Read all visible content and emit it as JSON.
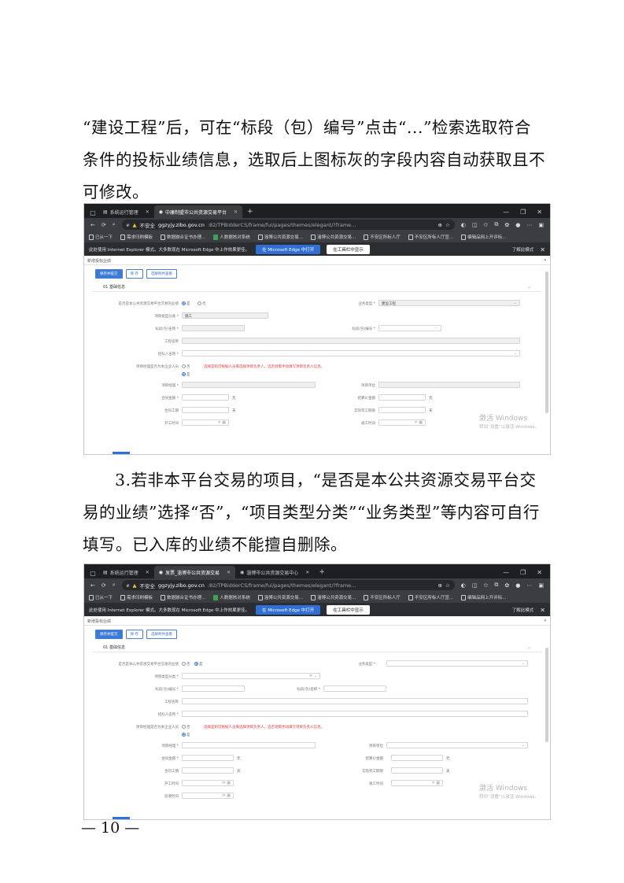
{
  "paragraph1": "“建设工程”后，可在“标段（包）编号”点击“...”检索选取符合条件的投标业绩信息，选取后上图标灰的字段内容自动获取且不可修改。",
  "paragraph2": "3.若非本平台交易的项目，“是否是本公共资源交易平台交易的业绩”选择“否”，“项目类型分类”“业务类型”等内容可自行填写。已入库的业绩不能擅自删除。",
  "page_number": "— 10 —",
  "screenshot1": {
    "tabs": [
      {
        "label": "系统运行管理",
        "active": false
      },
      {
        "label": "中康制盟市公共资源交易平台",
        "active": true
      }
    ],
    "address": {
      "security": "不安全",
      "host": "ggzyjy.zibo.gov.cn",
      "path": ":82/TPBidderCS/frame/fui/pages/themes/elegant/?frame..."
    },
    "bookmarks": [
      "已从一下",
      "需求印刷模板",
      "数据融合证书办理...",
      "人数据核对系统",
      "淄博公共资源交易...",
      "淄博公共资源交易...",
      "不安区所标人厅",
      "不安区所标人厅宣...",
      "编辑品网上开评标..."
    ],
    "ie_message": "此处使用 Internet Explorer 模式。大多数现在 Microsoft Edge 中上作效果更佳。",
    "ie_button1": "在 Microsoft Edge 中打开",
    "ie_button2": "在工具栏中显示",
    "ie_link": "了解此模式",
    "panel_title": "新增投标业绩",
    "buttons": [
      "保存并提交",
      "保 存",
      "选择附件查看"
    ],
    "section_title": "01 基础信息",
    "watermark_title": "激活 Windows",
    "watermark_sub": "转到“设置”以激活 Windows。",
    "form": {
      "q_platform": "是否是本公共资源交易平台交易的业绩",
      "opt_yes": "是",
      "opt_no": "否",
      "business_type_label": "业务类型",
      "business_type_value": "建设工程",
      "project_type_label": "项目类型分类",
      "project_type_value": "施工",
      "section_no_label": "标段(包)编号",
      "section_name_label": "标段(包)名称",
      "project_name_label": "工程名称",
      "tenderee_label": "招标人名称",
      "q_person": "项目经理是否为本企业人员",
      "warning": "选择是则可根据人员库选择项目负责人，选否则需手动填写项目负责人信息。",
      "manager_label": "项目经理",
      "manager_unit_label": "项目单位",
      "contract_amount_label": "合同金额",
      "settle_amount_label": "结算价金额",
      "duration_label": "合同工期",
      "actual_duration_label": "实际完工期限",
      "start_date_label": "开工时间",
      "finish_date_label": "竣工时间",
      "unit_yuan": "元",
      "unit_day": "天"
    }
  },
  "screenshot2": {
    "tabs": [
      {
        "label": "系统运行管理",
        "active": false
      },
      {
        "label": "发票_淄博市公共资源交易",
        "active": true
      },
      {
        "label": "淄博市公共资源交易中心",
        "active": false
      }
    ],
    "address": {
      "security": "不安全",
      "host": "ggzyjy.zibo.gov.cn",
      "path": ":82/TPBidderCS/frame/fui/pages/themes/elegant/?frame..."
    },
    "bookmarks": [
      "已从一下",
      "需求印刷模板",
      "数据融合证书办理...",
      "人数据核对系统",
      "淄博公共资源交易...",
      "淄博公共资源交易...",
      "不安区所标人厅",
      "不安区所标人厅宣...",
      "编辑品网上开评标..."
    ],
    "ie_message": "此处使用 Internet Explorer 模式。大多数现在 Microsoft Edge 中上作效果更佳。",
    "ie_button1": "在 Microsoft Edge 中打开",
    "ie_button2": "在工具栏中显示",
    "ie_link": "了解此模式",
    "panel_title": "新增投标业绩",
    "buttons": [
      "保存并提交",
      "保 存",
      "选择附件查看"
    ],
    "section_title": "01 基础信息",
    "watermark_title": "激活 Windows",
    "watermark_sub": "转到“设置”以激活 Windows。",
    "form": {
      "q_platform": "是否是本公共资源交易平台交易的业绩",
      "opt_yes": "是",
      "opt_no": "否",
      "business_type_label": "业务类型",
      "project_type_label": "项目类型分类",
      "section_no_label": "标段(包)编号",
      "section_name_label": "标段(包)名称",
      "project_name_label": "工程名称",
      "tenderee_label": "招标人名称",
      "q_person": "项目经理是否为本企业人员",
      "warning": "选择是则可根据人员库选择项目负责人，选否则需手动填写项目负责人信息。",
      "manager_label": "项目经理",
      "manager_unit_label": "项目单位",
      "contract_amount_label": "合同金额",
      "settle_amount_label": "结算价金额",
      "duration_label": "合同工期",
      "actual_duration_label": "实际完工期限",
      "start_date_label": "开工时间",
      "finish_date_label": "竣工时间",
      "other_label": "验收时间",
      "unit_yuan": "元",
      "unit_day": "天"
    }
  }
}
